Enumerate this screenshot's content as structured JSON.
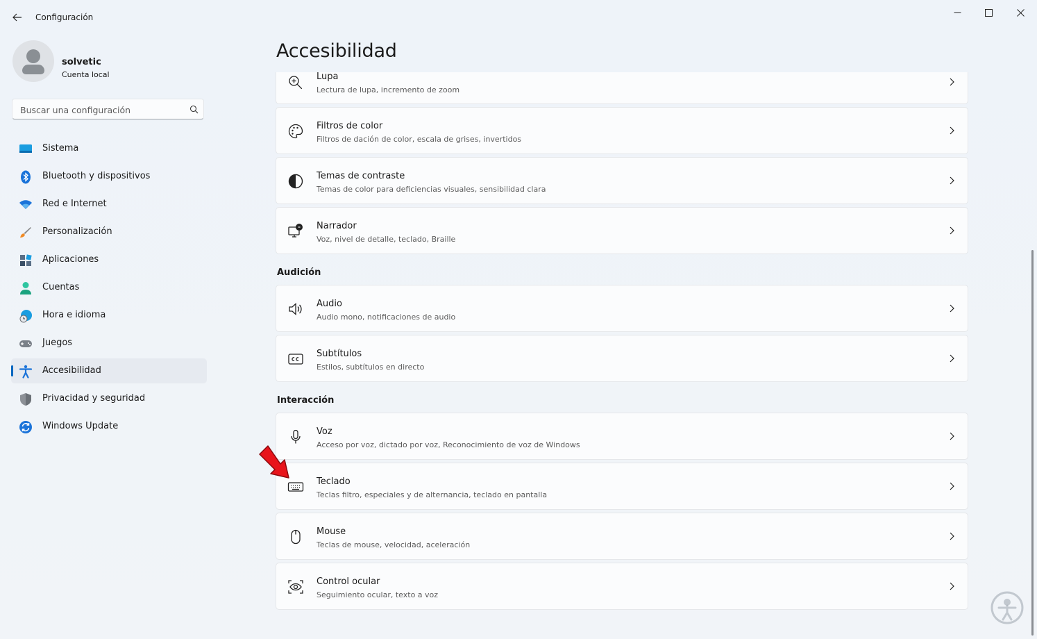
{
  "window": {
    "title": "Configuración"
  },
  "profile": {
    "name": "solvetic",
    "subtitle": "Cuenta local"
  },
  "search": {
    "placeholder": "Buscar una configuración"
  },
  "nav": {
    "items": [
      {
        "label": "Sistema",
        "icon": "monitor-icon"
      },
      {
        "label": "Bluetooth y dispositivos",
        "icon": "bluetooth-icon"
      },
      {
        "label": "Red e Internet",
        "icon": "wifi-icon"
      },
      {
        "label": "Personalización",
        "icon": "brush-icon"
      },
      {
        "label": "Aplicaciones",
        "icon": "apps-icon"
      },
      {
        "label": "Cuentas",
        "icon": "person-icon"
      },
      {
        "label": "Hora e idioma",
        "icon": "globe-clock-icon"
      },
      {
        "label": "Juegos",
        "icon": "gamepad-icon"
      },
      {
        "label": "Accesibilidad",
        "icon": "accessibility-icon",
        "active": true
      },
      {
        "label": "Privacidad y seguridad",
        "icon": "shield-icon"
      },
      {
        "label": "Windows Update",
        "icon": "update-icon"
      }
    ]
  },
  "page": {
    "title": "Accesibilidad"
  },
  "sections": {
    "audicion": "Audición",
    "interaccion": "Interacción"
  },
  "cards": {
    "lupa": {
      "title": "Lupa",
      "subtitle": "Lectura de lupa, incremento de zoom"
    },
    "filtros": {
      "title": "Filtros de color",
      "subtitle": "Filtros de dación de color, escala de grises, invertidos"
    },
    "temas": {
      "title": "Temas de contraste",
      "subtitle": "Temas de color para deficiencias visuales, sensibilidad clara"
    },
    "narrador": {
      "title": "Narrador",
      "subtitle": "Voz, nivel de detalle, teclado, Braille"
    },
    "audio": {
      "title": "Audio",
      "subtitle": "Audio mono, notificaciones de audio"
    },
    "subtitulos": {
      "title": "Subtítulos",
      "subtitle": "Estilos, subtítulos en directo"
    },
    "voz": {
      "title": "Voz",
      "subtitle": "Acceso por voz, dictado por voz, Reconocimiento de voz de Windows"
    },
    "teclado": {
      "title": "Teclado",
      "subtitle": "Teclas filtro, especiales y de alternancia, teclado en pantalla"
    },
    "mouse": {
      "title": "Mouse",
      "subtitle": "Teclas de mouse, velocidad, aceleración"
    },
    "ocular": {
      "title": "Control ocular",
      "subtitle": "Seguimiento ocular, texto a voz"
    }
  },
  "colors": {
    "accent": "#0067c0",
    "annotation": "#e8141b"
  }
}
